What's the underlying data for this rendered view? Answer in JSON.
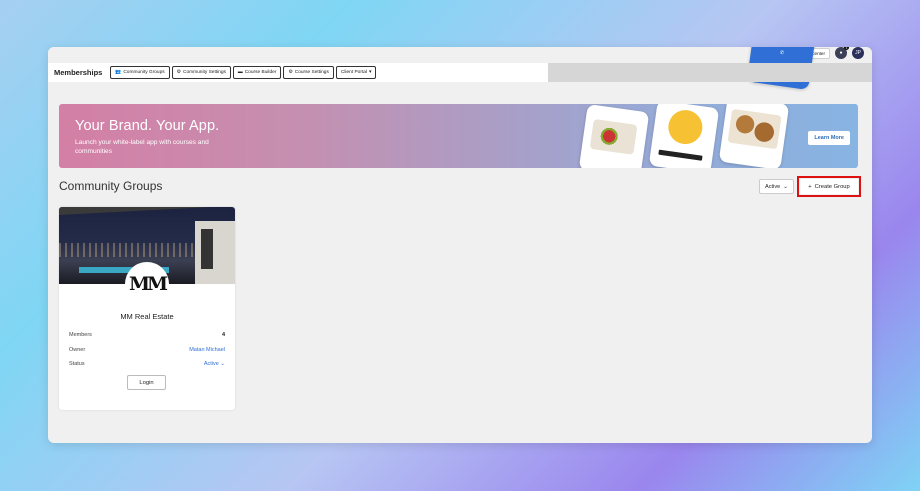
{
  "topbar": {
    "my_tasks": "My Tasks",
    "help_center": "Help Center",
    "notification_count": "1",
    "avatar_initials": "JP"
  },
  "nav": {
    "title": "Memberships",
    "tabs": [
      {
        "label": "Community Groups",
        "icon": "people-icon"
      },
      {
        "label": "Community Settings",
        "icon": "gear-icon"
      },
      {
        "label": "Course Builder",
        "icon": "monitor-icon"
      },
      {
        "label": "Course Settings",
        "icon": "gear-icon"
      },
      {
        "label": "Client Portal",
        "icon": "chevron-down-icon"
      }
    ]
  },
  "banner": {
    "title": "Your Brand. Your App.",
    "subtitle": "Launch your white-label app with courses and communities",
    "cta": "Learn More"
  },
  "section": {
    "title": "Community Groups",
    "filter_value": "Active",
    "create_label": "Create Group"
  },
  "group_card": {
    "logo_text": "MM",
    "name": "MM Real Estate",
    "members_label": "Members",
    "members_value": "4",
    "owner_label": "Owner",
    "owner_value": "Matan Michael",
    "status_label": "Status",
    "status_value": "Active",
    "login_label": "Login"
  },
  "colors": {
    "accent": "#2f6fd6",
    "highlight_border": "#dd1111",
    "banner_start": "#d47fa5",
    "banner_end": "#87b4e3"
  }
}
